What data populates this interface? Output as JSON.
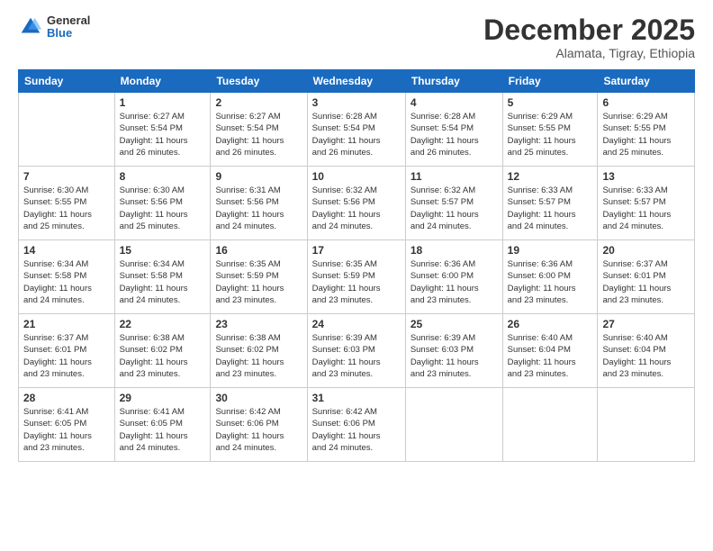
{
  "logo": {
    "general": "General",
    "blue": "Blue"
  },
  "header": {
    "month": "December 2025",
    "location": "Alamata, Tigray, Ethiopia"
  },
  "weekdays": [
    "Sunday",
    "Monday",
    "Tuesday",
    "Wednesday",
    "Thursday",
    "Friday",
    "Saturday"
  ],
  "weeks": [
    [
      {
        "day": "",
        "info": ""
      },
      {
        "day": "1",
        "info": "Sunrise: 6:27 AM\nSunset: 5:54 PM\nDaylight: 11 hours\nand 26 minutes."
      },
      {
        "day": "2",
        "info": "Sunrise: 6:27 AM\nSunset: 5:54 PM\nDaylight: 11 hours\nand 26 minutes."
      },
      {
        "day": "3",
        "info": "Sunrise: 6:28 AM\nSunset: 5:54 PM\nDaylight: 11 hours\nand 26 minutes."
      },
      {
        "day": "4",
        "info": "Sunrise: 6:28 AM\nSunset: 5:54 PM\nDaylight: 11 hours\nand 26 minutes."
      },
      {
        "day": "5",
        "info": "Sunrise: 6:29 AM\nSunset: 5:55 PM\nDaylight: 11 hours\nand 25 minutes."
      },
      {
        "day": "6",
        "info": "Sunrise: 6:29 AM\nSunset: 5:55 PM\nDaylight: 11 hours\nand 25 minutes."
      }
    ],
    [
      {
        "day": "7",
        "info": "Sunrise: 6:30 AM\nSunset: 5:55 PM\nDaylight: 11 hours\nand 25 minutes."
      },
      {
        "day": "8",
        "info": "Sunrise: 6:30 AM\nSunset: 5:56 PM\nDaylight: 11 hours\nand 25 minutes."
      },
      {
        "day": "9",
        "info": "Sunrise: 6:31 AM\nSunset: 5:56 PM\nDaylight: 11 hours\nand 24 minutes."
      },
      {
        "day": "10",
        "info": "Sunrise: 6:32 AM\nSunset: 5:56 PM\nDaylight: 11 hours\nand 24 minutes."
      },
      {
        "day": "11",
        "info": "Sunrise: 6:32 AM\nSunset: 5:57 PM\nDaylight: 11 hours\nand 24 minutes."
      },
      {
        "day": "12",
        "info": "Sunrise: 6:33 AM\nSunset: 5:57 PM\nDaylight: 11 hours\nand 24 minutes."
      },
      {
        "day": "13",
        "info": "Sunrise: 6:33 AM\nSunset: 5:57 PM\nDaylight: 11 hours\nand 24 minutes."
      }
    ],
    [
      {
        "day": "14",
        "info": "Sunrise: 6:34 AM\nSunset: 5:58 PM\nDaylight: 11 hours\nand 24 minutes."
      },
      {
        "day": "15",
        "info": "Sunrise: 6:34 AM\nSunset: 5:58 PM\nDaylight: 11 hours\nand 24 minutes."
      },
      {
        "day": "16",
        "info": "Sunrise: 6:35 AM\nSunset: 5:59 PM\nDaylight: 11 hours\nand 23 minutes."
      },
      {
        "day": "17",
        "info": "Sunrise: 6:35 AM\nSunset: 5:59 PM\nDaylight: 11 hours\nand 23 minutes."
      },
      {
        "day": "18",
        "info": "Sunrise: 6:36 AM\nSunset: 6:00 PM\nDaylight: 11 hours\nand 23 minutes."
      },
      {
        "day": "19",
        "info": "Sunrise: 6:36 AM\nSunset: 6:00 PM\nDaylight: 11 hours\nand 23 minutes."
      },
      {
        "day": "20",
        "info": "Sunrise: 6:37 AM\nSunset: 6:01 PM\nDaylight: 11 hours\nand 23 minutes."
      }
    ],
    [
      {
        "day": "21",
        "info": "Sunrise: 6:37 AM\nSunset: 6:01 PM\nDaylight: 11 hours\nand 23 minutes."
      },
      {
        "day": "22",
        "info": "Sunrise: 6:38 AM\nSunset: 6:02 PM\nDaylight: 11 hours\nand 23 minutes."
      },
      {
        "day": "23",
        "info": "Sunrise: 6:38 AM\nSunset: 6:02 PM\nDaylight: 11 hours\nand 23 minutes."
      },
      {
        "day": "24",
        "info": "Sunrise: 6:39 AM\nSunset: 6:03 PM\nDaylight: 11 hours\nand 23 minutes."
      },
      {
        "day": "25",
        "info": "Sunrise: 6:39 AM\nSunset: 6:03 PM\nDaylight: 11 hours\nand 23 minutes."
      },
      {
        "day": "26",
        "info": "Sunrise: 6:40 AM\nSunset: 6:04 PM\nDaylight: 11 hours\nand 23 minutes."
      },
      {
        "day": "27",
        "info": "Sunrise: 6:40 AM\nSunset: 6:04 PM\nDaylight: 11 hours\nand 23 minutes."
      }
    ],
    [
      {
        "day": "28",
        "info": "Sunrise: 6:41 AM\nSunset: 6:05 PM\nDaylight: 11 hours\nand 23 minutes."
      },
      {
        "day": "29",
        "info": "Sunrise: 6:41 AM\nSunset: 6:05 PM\nDaylight: 11 hours\nand 24 minutes."
      },
      {
        "day": "30",
        "info": "Sunrise: 6:42 AM\nSunset: 6:06 PM\nDaylight: 11 hours\nand 24 minutes."
      },
      {
        "day": "31",
        "info": "Sunrise: 6:42 AM\nSunset: 6:06 PM\nDaylight: 11 hours\nand 24 minutes."
      },
      {
        "day": "",
        "info": ""
      },
      {
        "day": "",
        "info": ""
      },
      {
        "day": "",
        "info": ""
      }
    ]
  ]
}
